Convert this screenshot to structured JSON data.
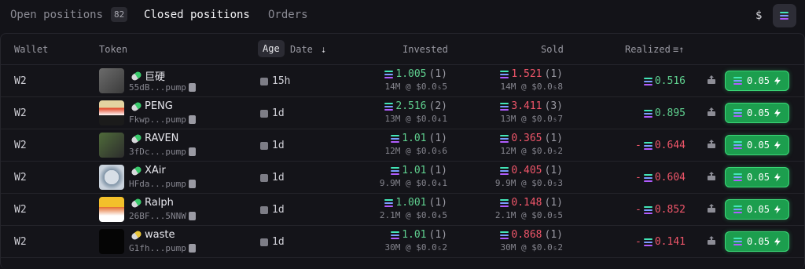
{
  "tabs": {
    "open_label": "Open positions",
    "open_count": "82",
    "closed_label": "Closed positions",
    "orders_label": "Orders"
  },
  "currency": {
    "dollar": "$"
  },
  "headers": {
    "wallet": "Wallet",
    "token": "Token",
    "age": "Age",
    "date": "Date",
    "invested": "Invested",
    "sold": "Sold",
    "realized": "Realized"
  },
  "colors": {
    "profit": "#5fd08f",
    "loss": "#f0566a",
    "buy_button": "#1c9e4e"
  },
  "rows": [
    {
      "wallet": "W2",
      "name": "巨硬",
      "addr": "55dB...pump",
      "age": "15h",
      "inv_amt": "1.005",
      "inv_n": "(1)",
      "inv_sub": "14M @ $0.0₅5",
      "sold_amt": "1.521",
      "sold_n": "(1)",
      "sold_sub": "14M @ $0.0₅8",
      "realized": "0.516",
      "neg": "",
      "buy": "0.05",
      "pill": "green"
    },
    {
      "wallet": "W2",
      "name": "PENG",
      "addr": "Fkwp...pump",
      "age": "1d",
      "inv_amt": "2.516",
      "inv_n": "(2)",
      "inv_sub": "13M @ $0.0₄1",
      "sold_amt": "3.411",
      "sold_n": "(3)",
      "sold_sub": "13M @ $0.0₅7",
      "realized": "0.895",
      "neg": "",
      "buy": "0.05",
      "pill": "green"
    },
    {
      "wallet": "W2",
      "name": "RAVEN",
      "addr": "3fDc...pump",
      "age": "1d",
      "inv_amt": "1.01",
      "inv_n": "(1)",
      "inv_sub": "12M @ $0.0₅6",
      "sold_amt": "0.365",
      "sold_n": "(1)",
      "sold_sub": "12M @ $0.0₅2",
      "realized": "0.644",
      "neg": "-",
      "buy": "0.05",
      "pill": "green"
    },
    {
      "wallet": "W2",
      "name": "XAir",
      "addr": "HFda...pump",
      "age": "1d",
      "inv_amt": "1.01",
      "inv_n": "(1)",
      "inv_sub": "9.9M @ $0.0₄1",
      "sold_amt": "0.405",
      "sold_n": "(1)",
      "sold_sub": "9.9M @ $0.0₅3",
      "realized": "0.604",
      "neg": "-",
      "buy": "0.05",
      "pill": "green"
    },
    {
      "wallet": "W2",
      "name": "Ralph",
      "addr": "26BF...5NNW",
      "age": "1d",
      "inv_amt": "1.001",
      "inv_n": "(1)",
      "inv_sub": "2.1M @ $0.0₄5",
      "sold_amt": "0.148",
      "sold_n": "(1)",
      "sold_sub": "2.1M @ $0.0₅5",
      "realized": "0.852",
      "neg": "-",
      "buy": "0.05",
      "pill": "green"
    },
    {
      "wallet": "W2",
      "name": "waste",
      "addr": "G1fh...pump",
      "age": "1d",
      "inv_amt": "1.01",
      "inv_n": "(1)",
      "inv_sub": "30M @ $0.0₅2",
      "sold_amt": "0.868",
      "sold_n": "(1)",
      "sold_sub": "30M @ $0.0₅2",
      "realized": "0.141",
      "neg": "-",
      "buy": "0.05",
      "pill": "yellow"
    }
  ]
}
